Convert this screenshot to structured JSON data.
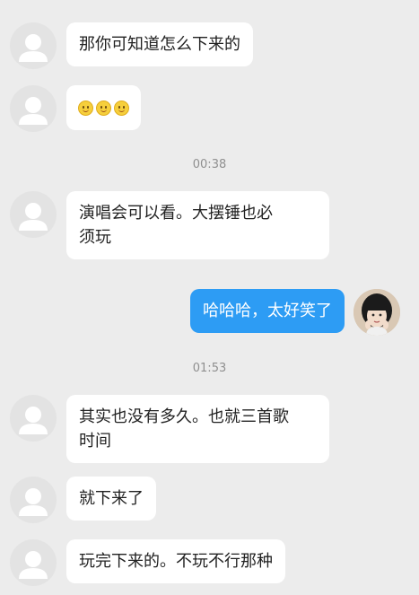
{
  "colors": {
    "background": "#ececec",
    "incoming_bubble": "#ffffff",
    "outgoing_bubble": "#2d9cf4",
    "timestamp_text": "#8f8f8f"
  },
  "messages": [
    {
      "id": "m1",
      "side": "incoming",
      "text": "那你可知道怎么下来的"
    },
    {
      "id": "m2",
      "side": "incoming",
      "emoji": [
        "smile-emoji",
        "smile-emoji",
        "smile-emoji"
      ]
    },
    {
      "id": "t1",
      "type": "timestamp",
      "text": "00:38"
    },
    {
      "id": "m3",
      "side": "incoming",
      "lines": [
        "演唱会可以看。大摆锤也必",
        "须玩"
      ]
    },
    {
      "id": "m4",
      "side": "outgoing",
      "text": "哈哈哈，太好笑了"
    },
    {
      "id": "t2",
      "type": "timestamp",
      "text": "01:53"
    },
    {
      "id": "m5",
      "side": "incoming",
      "lines": [
        "其实也没有多久。也就三首歌",
        "时间"
      ]
    },
    {
      "id": "m6",
      "side": "incoming",
      "text": "就下来了"
    },
    {
      "id": "m7",
      "side": "incoming",
      "text": "玩完下来的。不玩不行那种"
    }
  ]
}
